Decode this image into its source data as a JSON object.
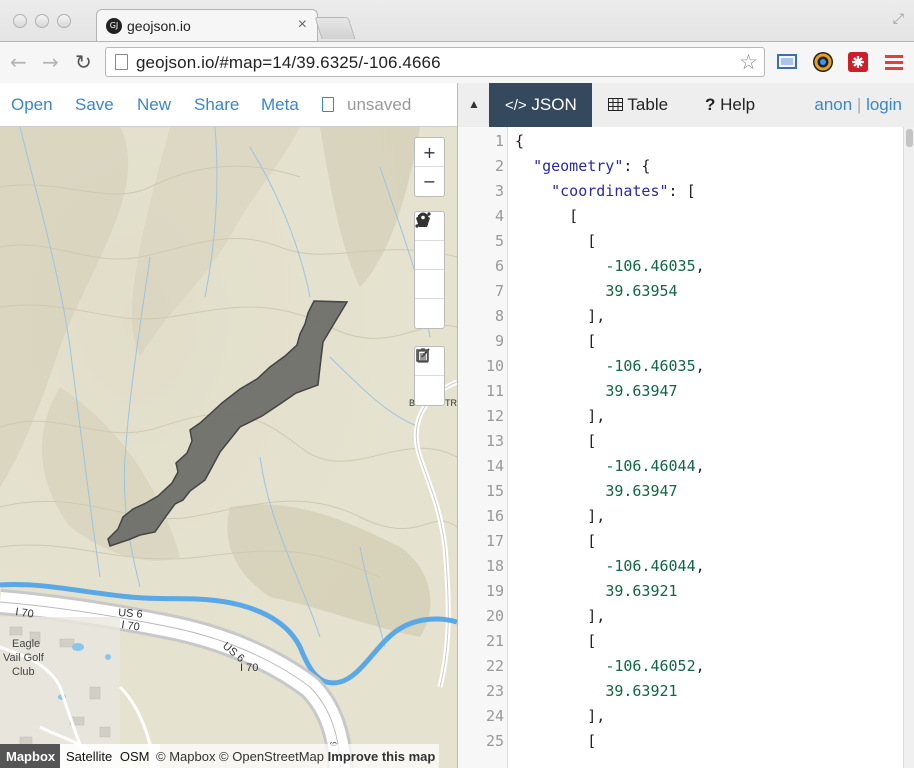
{
  "browser": {
    "tab_title": "geojson.io",
    "tab_favicon": "GJ",
    "tab_close": "×",
    "url": "geojson.io/#map=14/39.6325/-106.4666",
    "back": "←",
    "forward": "→",
    "reload": "↻",
    "star": "☆",
    "restore": "⤢"
  },
  "app_nav": {
    "open": "Open",
    "save": "Save",
    "new": "New",
    "share": "Share",
    "meta": "Meta",
    "status": "unsaved"
  },
  "map": {
    "controls": {
      "search": "⌕",
      "zoom_in": "+",
      "zoom_out": "−"
    },
    "labels": {
      "us6_a": "US 6",
      "i70_a": "I 70",
      "i70_b": "I 70",
      "us6_b": "US 6",
      "i70_c": "I 70",
      "eagle": "Eagle",
      "vail_golf": "Vail Golf",
      "club": "Club",
      "cut_left": "B",
      "cut_tr": "TR",
      "cut_bottom": "6"
    },
    "footer": {
      "logo": "Mapbox",
      "layers": [
        "Satellite",
        "OSM"
      ],
      "attribution": "© Mapbox © OpenStreetMap",
      "improve": "Improve this map"
    }
  },
  "panel": {
    "tabs": [
      {
        "label": "JSON",
        "icon": "</>"
      },
      {
        "label": "Table",
        "icon": "table-icon"
      },
      {
        "label": "Help",
        "icon": "?"
      }
    ],
    "active_tab": "JSON",
    "login": "login",
    "user": "anon",
    "separator": "|"
  },
  "editor": {
    "lines": [
      {
        "n": "1",
        "text": "{"
      },
      {
        "n": "2",
        "text": "  \"geometry\": {"
      },
      {
        "n": "3",
        "text": "    \"coordinates\": ["
      },
      {
        "n": "4",
        "text": "      ["
      },
      {
        "n": "5",
        "text": "        ["
      },
      {
        "n": "6",
        "text": "          -106.46035,"
      },
      {
        "n": "7",
        "text": "          39.63954"
      },
      {
        "n": "8",
        "text": "        ],"
      },
      {
        "n": "9",
        "text": "        ["
      },
      {
        "n": "10",
        "text": "          -106.46035,"
      },
      {
        "n": "11",
        "text": "          39.63947"
      },
      {
        "n": "12",
        "text": "        ],"
      },
      {
        "n": "13",
        "text": "        ["
      },
      {
        "n": "14",
        "text": "          -106.46044,"
      },
      {
        "n": "15",
        "text": "          39.63947"
      },
      {
        "n": "16",
        "text": "        ],"
      },
      {
        "n": "17",
        "text": "        ["
      },
      {
        "n": "18",
        "text": "          -106.46044,"
      },
      {
        "n": "19",
        "text": "          39.63921"
      },
      {
        "n": "20",
        "text": "        ],"
      },
      {
        "n": "21",
        "text": "        ["
      },
      {
        "n": "22",
        "text": "          -106.46052,"
      },
      {
        "n": "23",
        "text": "          39.63921"
      },
      {
        "n": "24",
        "text": "        ],"
      },
      {
        "n": "25",
        "text": "        ["
      }
    ]
  },
  "colors": {
    "link": "#3a87c8",
    "active_tab_bg": "#34495e",
    "json_key": "#2a2aa8",
    "json_number": "#116644",
    "map_terrain": "#e5e2cf",
    "river": "#5aa9e6",
    "polygon": "#6b6b68"
  }
}
